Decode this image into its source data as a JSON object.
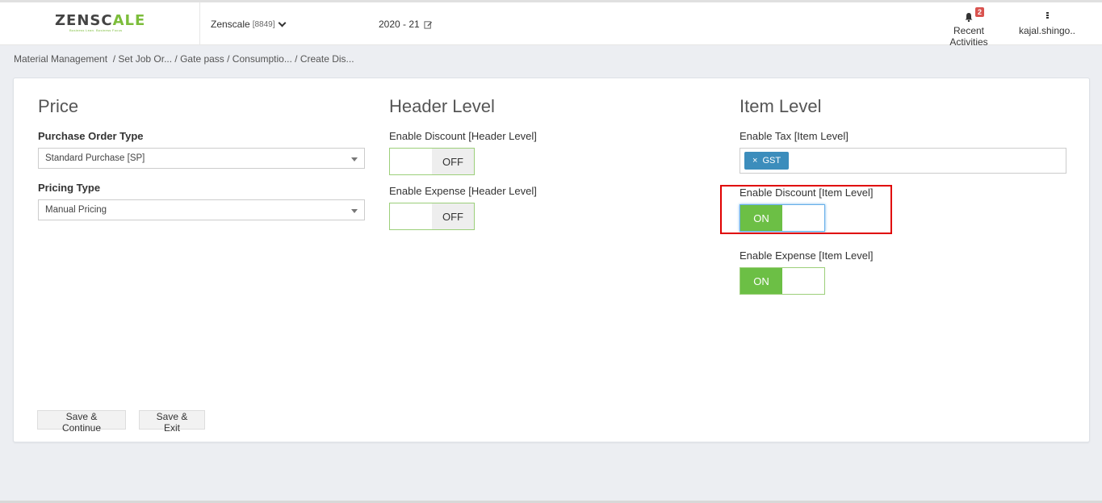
{
  "header": {
    "logo_left": "ZENSC",
    "logo_mid": "A",
    "logo_right": "LE",
    "logo_tagline": "Business Lean. Business Focus",
    "company_name": "Zenscale",
    "company_code": "[8849]",
    "fiscal_year": "2020 - 21",
    "activities_label": "Recent Activities",
    "notification_count": "2",
    "user_name": "kajal.shingo.."
  },
  "breadcrumb": [
    "Material Management ",
    " / Set Job Or...",
    " / Gate pass",
    " / Consumptio...",
    " / Create Dis..."
  ],
  "price": {
    "heading": "Price",
    "order_type_label": "Purchase Order Type",
    "order_type_value": "Standard Purchase [SP]",
    "pricing_type_label": "Pricing Type",
    "pricing_type_value": "Manual Pricing"
  },
  "header_level": {
    "heading": "Header Level",
    "discount_label": "Enable Discount [Header Level]",
    "discount_state": "OFF",
    "expense_label": "Enable Expense [Header Level]",
    "expense_state": "OFF"
  },
  "item_level": {
    "heading": "Item Level",
    "tax_label": "Enable Tax [Item Level]",
    "tax_tag": "GST",
    "tag_remove": "×",
    "discount_label": "Enable Discount [Item Level]",
    "discount_state": "ON",
    "expense_label": "Enable Expense [Item Level]",
    "expense_state": "ON"
  },
  "actions": {
    "save_continue": "Save & Continue",
    "save_exit": "Save & Exit"
  },
  "colors": {
    "brand_green": "#7cbd3b",
    "toggle_on": "#6cbf45",
    "tag_blue": "#3c8dbc",
    "highlight_red": "#e00000",
    "badge_red": "#d9534f"
  }
}
